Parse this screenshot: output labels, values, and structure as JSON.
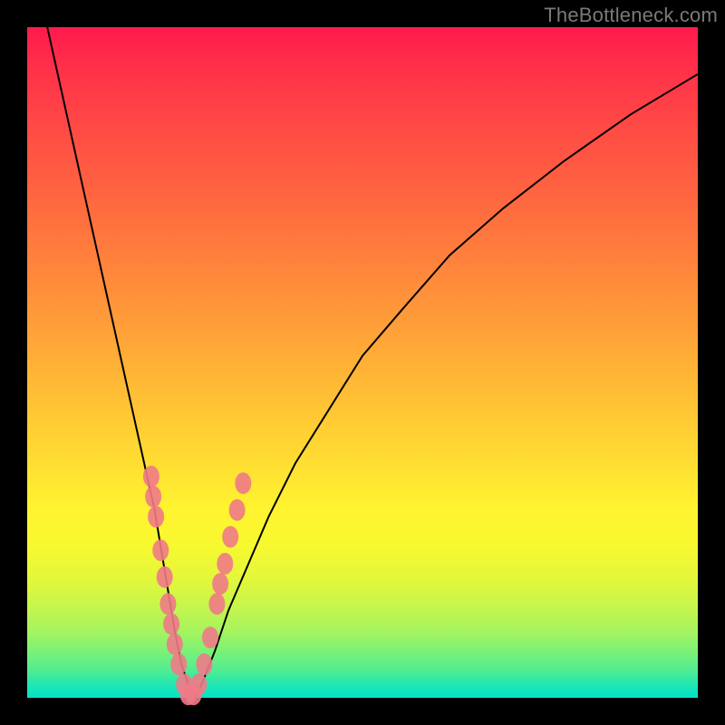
{
  "watermark": "TheBottleneck.com",
  "colors": {
    "frame_bg": "#000000",
    "curve_stroke": "#000000",
    "dot_fill": "#f07a87",
    "gradient_top": "#ff1a4d",
    "gradient_bottom": "#00e3c6"
  },
  "chart_data": {
    "type": "line",
    "title": "",
    "xlabel": "",
    "ylabel": "",
    "xlim": [
      0,
      100
    ],
    "ylim": [
      0,
      100
    ],
    "grid": false,
    "legend": false,
    "series": [
      {
        "name": "bottleneck-curve",
        "x": [
          3,
          5,
          7,
          9,
          11,
          13,
          15,
          17,
          19,
          20,
          21,
          22,
          23,
          24,
          25,
          26,
          28,
          30,
          33,
          36,
          40,
          45,
          50,
          56,
          63,
          71,
          80,
          90,
          100
        ],
        "y": [
          100,
          91,
          82,
          73,
          64,
          55,
          46,
          37,
          28,
          22,
          16,
          10,
          5,
          2,
          0,
          2,
          7,
          13,
          20,
          27,
          35,
          43,
          51,
          58,
          66,
          73,
          80,
          87,
          93
        ]
      }
    ],
    "scatter_points": {
      "name": "sample-configs",
      "points": [
        {
          "x": 18.5,
          "y": 33
        },
        {
          "x": 18.8,
          "y": 30
        },
        {
          "x": 19.2,
          "y": 27
        },
        {
          "x": 19.9,
          "y": 22
        },
        {
          "x": 20.5,
          "y": 18
        },
        {
          "x": 21.0,
          "y": 14
        },
        {
          "x": 21.5,
          "y": 11
        },
        {
          "x": 22.0,
          "y": 8
        },
        {
          "x": 22.6,
          "y": 5
        },
        {
          "x": 23.4,
          "y": 2
        },
        {
          "x": 24.0,
          "y": 0.5
        },
        {
          "x": 24.8,
          "y": 0.5
        },
        {
          "x": 25.6,
          "y": 2
        },
        {
          "x": 26.4,
          "y": 5
        },
        {
          "x": 27.3,
          "y": 9
        },
        {
          "x": 28.3,
          "y": 14
        },
        {
          "x": 28.8,
          "y": 17
        },
        {
          "x": 29.5,
          "y": 20
        },
        {
          "x": 30.3,
          "y": 24
        },
        {
          "x": 31.3,
          "y": 28
        },
        {
          "x": 32.2,
          "y": 32
        }
      ]
    }
  }
}
